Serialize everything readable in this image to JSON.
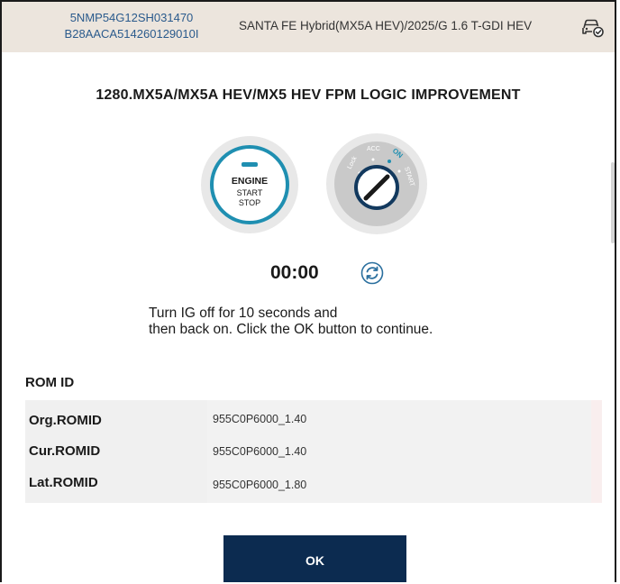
{
  "header": {
    "vin": "5NMP54G12SH031470",
    "vin_secondary": "B28AACA514260129010I",
    "vehicle": "SANTA FE Hybrid(MX5A HEV)/2025/G 1.6 T-GDI HEV",
    "vehicle_icon": "car-check-icon"
  },
  "procedure": {
    "title": "1280.MX5A/MX5A HEV/MX5 HEV FPM LOGIC IMPROVEMENT",
    "engine_button": {
      "line1": "ENGINE",
      "line2": "START",
      "line3": "STOP"
    },
    "ignition": {
      "positions": [
        "Lock",
        "ACC",
        "ON",
        "START"
      ]
    },
    "timer": "00:00",
    "refresh_icon": "refresh-icon",
    "instruction_line1": "Turn IG off for 10 seconds and",
    "instruction_line2": "then back on. Click the OK button to continue."
  },
  "rom": {
    "title": "ROM ID",
    "rows": [
      {
        "label": "Org.ROMID",
        "value": "955C0P6000_1.40"
      },
      {
        "label": "Cur.ROMID",
        "value": "955C0P6000_1.40"
      },
      {
        "label": "Lat.ROMID",
        "value": "955C0P6000_1.80"
      }
    ]
  },
  "actions": {
    "ok_label": "OK"
  },
  "colors": {
    "header_bg": "#ece5dd",
    "vin_text": "#2a5a8c",
    "accent": "#1f8fb1",
    "ok_button": "#0c2b50"
  }
}
